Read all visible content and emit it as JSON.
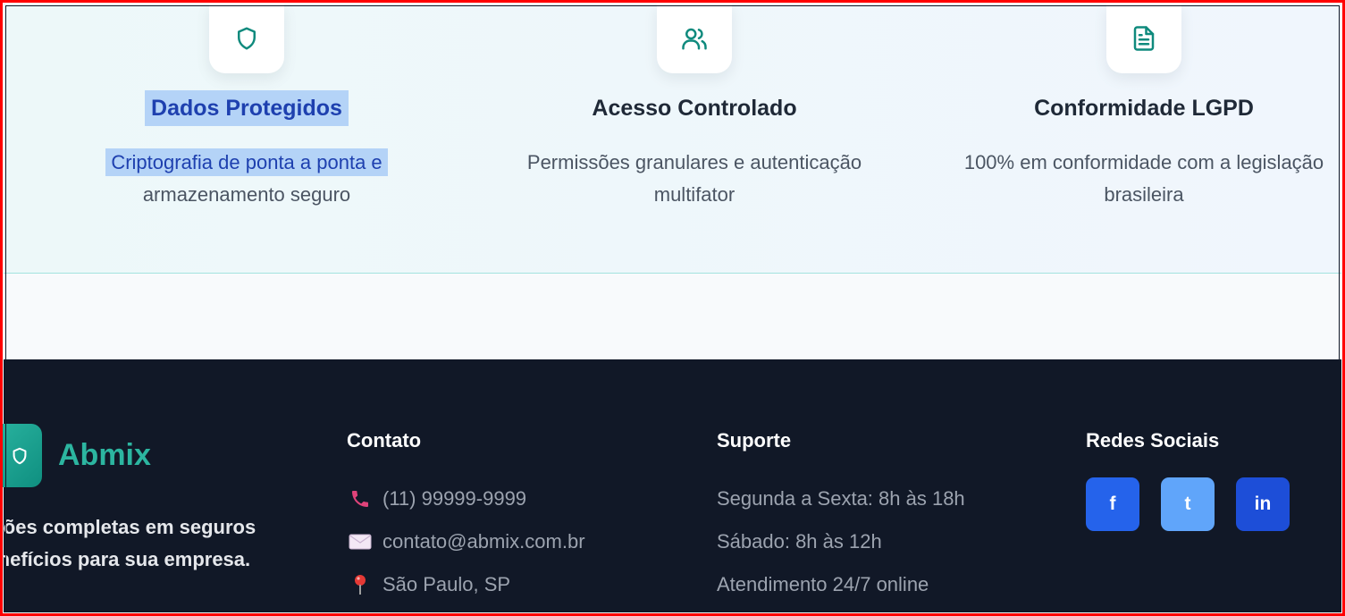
{
  "features": [
    {
      "icon": "shield-icon",
      "title": "Dados Protegidos",
      "line1": "Criptografia de ponta a ponta e",
      "line2": "armazenamento seguro"
    },
    {
      "icon": "users-icon",
      "title": "Acesso Controlado",
      "line1": "Permissões granulares e autenticação",
      "line2": "multifator"
    },
    {
      "icon": "document-icon",
      "title": "Conformidade LGPD",
      "line1": "100% em conformidade com a legislação",
      "line2": "brasileira"
    }
  ],
  "footer": {
    "brand": {
      "name": "Abmix",
      "desc_line1": "luções completas em seguros",
      "desc_line2": "benefícios para sua empresa."
    },
    "contact": {
      "title": "Contato",
      "items": [
        {
          "icon": "phone-icon",
          "text": "(11) 99999-9999"
        },
        {
          "icon": "envelope-icon",
          "text": "contato@abmix.com.br"
        },
        {
          "icon": "pin-icon",
          "text": "São Paulo, SP"
        }
      ]
    },
    "support": {
      "title": "Suporte",
      "items": [
        "Segunda a Sexta: 8h às 18h",
        "Sábado: 8h às 12h",
        "Atendimento 24/7 online"
      ]
    },
    "social": {
      "title": "Redes Sociais",
      "buttons": [
        {
          "label": "f",
          "icon": "facebook-icon",
          "color": "#2563eb"
        },
        {
          "label": "t",
          "icon": "twitter-icon",
          "color": "#60a5fa"
        },
        {
          "label": "in",
          "icon": "linkedin-icon",
          "color": "#1d4ed8"
        }
      ]
    }
  },
  "colors": {
    "accent": "#2cb5a0",
    "footer_bg": "#111827",
    "selection": "#b4d3f7"
  }
}
